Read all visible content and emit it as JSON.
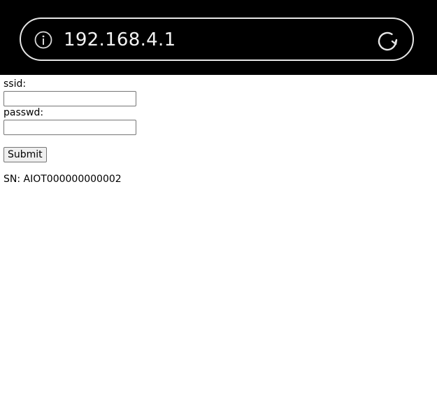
{
  "browser": {
    "url": "192.168.4.1",
    "info_icon": "info-icon",
    "reload_icon": "reload-icon"
  },
  "form": {
    "ssid_label": "ssid:",
    "ssid_value": "",
    "passwd_label": "passwd:",
    "passwd_value": "",
    "submit_label": "Submit"
  },
  "device": {
    "sn_text": "SN: AIOT000000000002"
  }
}
